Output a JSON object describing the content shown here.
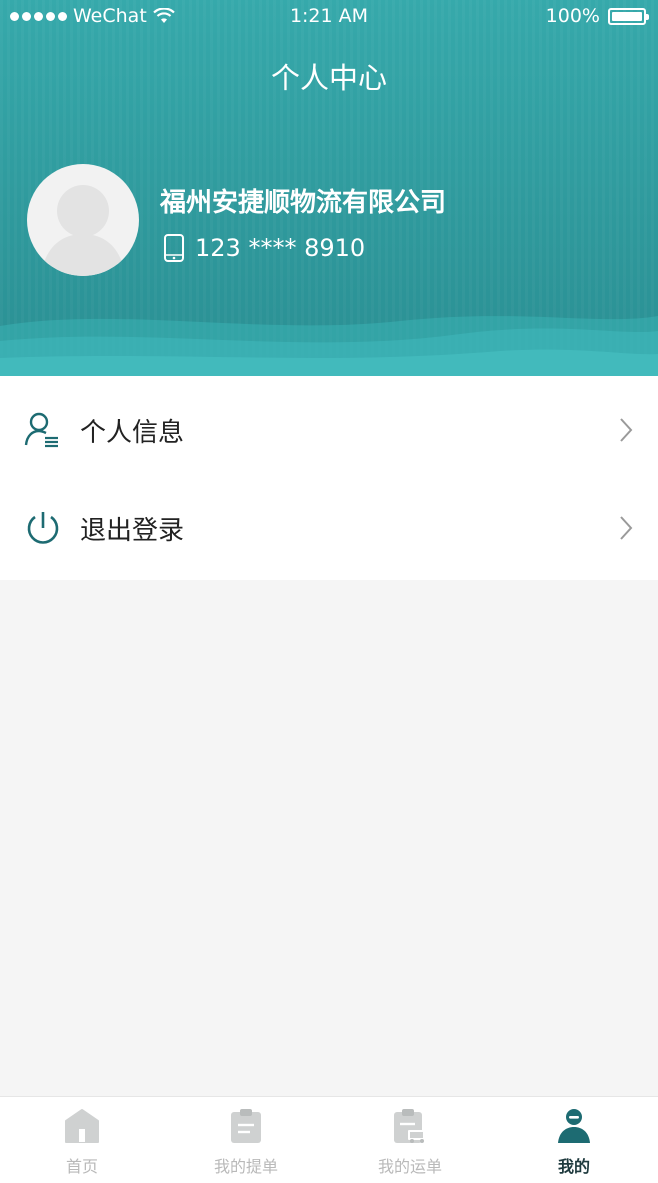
{
  "status_bar": {
    "carrier": "WeChat",
    "time": "1:21 AM",
    "battery": "100%"
  },
  "header": {
    "title": "个人中心",
    "company_name": "福州安捷顺物流有限公司",
    "phone": "123 **** 8910"
  },
  "menu": {
    "items": [
      {
        "label": "个人信息",
        "icon": "user-list-icon"
      },
      {
        "label": "退出登录",
        "icon": "power-icon"
      }
    ]
  },
  "tabbar": {
    "items": [
      {
        "label": "首页",
        "icon": "home-icon",
        "active": false
      },
      {
        "label": "我的提单",
        "icon": "clipboard-icon",
        "active": false
      },
      {
        "label": "我的运单",
        "icon": "clipboard-truck-icon",
        "active": false
      },
      {
        "label": "我的",
        "icon": "person-icon",
        "active": true
      }
    ]
  },
  "colors": {
    "header": "#2f9a9d",
    "accent": "#1d6b72",
    "inactive": "#c7c7c7"
  }
}
